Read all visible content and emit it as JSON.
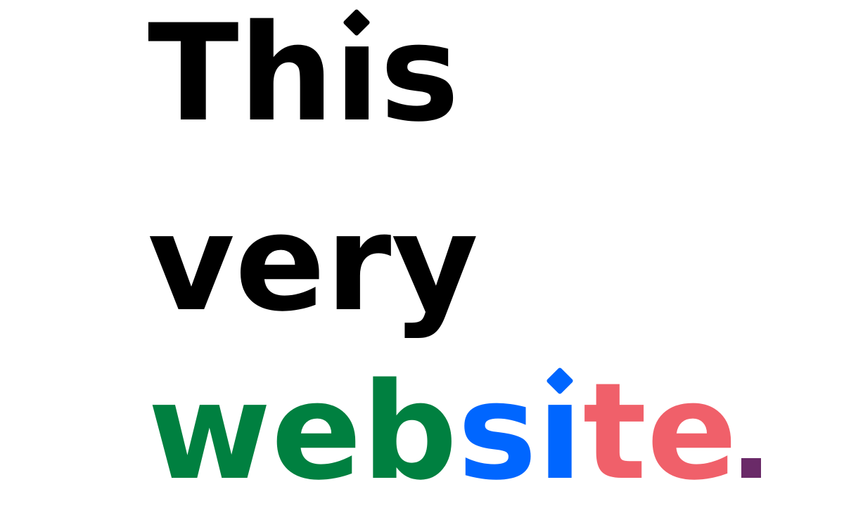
{
  "headline": {
    "line1": {
      "before_i": "Th",
      "i": "ı",
      "after_i": "s"
    },
    "line2": {
      "text": "very"
    },
    "line3": {
      "part1": "web",
      "part2": "s",
      "part3_i": "ı",
      "part4": "te",
      "period": "."
    }
  },
  "colors": {
    "black": "#000000",
    "green": "#008040",
    "blue": "#0066ff",
    "coral": "#f0606a",
    "purple": "#6a2a68"
  }
}
